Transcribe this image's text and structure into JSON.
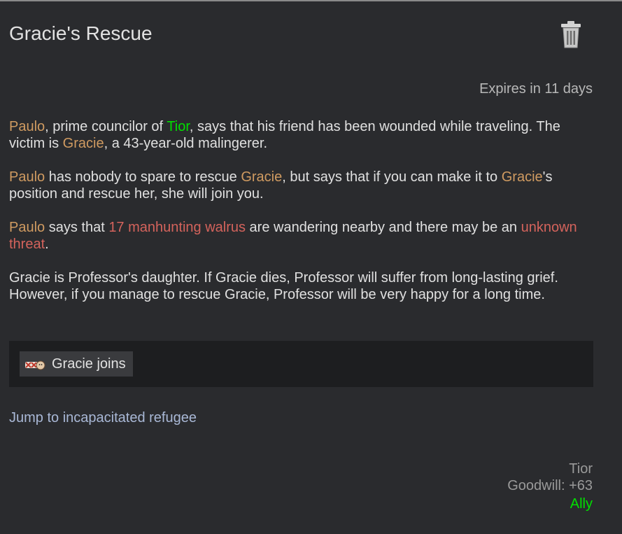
{
  "quest": {
    "title": "Gracie's Rescue",
    "expires": "Expires in 11 days"
  },
  "description": {
    "p1": {
      "t1": "Paulo",
      "t2": ", prime councilor of ",
      "t3": "Tior",
      "t4": ", says that his friend has been wounded while traveling. The victim is ",
      "t5": "Gracie",
      "t6": ", a 43-year-old malingerer."
    },
    "p2": {
      "t1": "Paulo",
      "t2": " has nobody to spare to rescue ",
      "t3": "Gracie",
      "t4": ", but says that if you can make it to ",
      "t5": "Gracie",
      "t6": "'s position and rescue her, she will join you."
    },
    "p3": {
      "t1": "Paulo",
      "t2": " says that ",
      "t3": "17 manhunting walrus",
      "t4": " are wandering nearby and there may be an ",
      "t5": "unknown threat",
      "t6": "."
    },
    "p4": "Gracie is Professor's daughter. If Gracie dies, Professor will suffer from long-lasting grief. However, if you manage to rescue Gracie, Professor will be very happy for a long time."
  },
  "rewards": {
    "item_label": "Gracie joins"
  },
  "jump_link": "Jump to incapacitated refugee",
  "faction": {
    "name": "Tior",
    "goodwill": "Goodwill: +63",
    "relation": "Ally"
  },
  "colors": {
    "background": "#2a2b2e",
    "pawn_name": "#d09b61",
    "faction_name": "#00e000",
    "threat": "#d4635c",
    "link": "#a9b8d6"
  },
  "icons": {
    "delete": "trash-icon",
    "reward": "pawn-portrait-icon"
  }
}
